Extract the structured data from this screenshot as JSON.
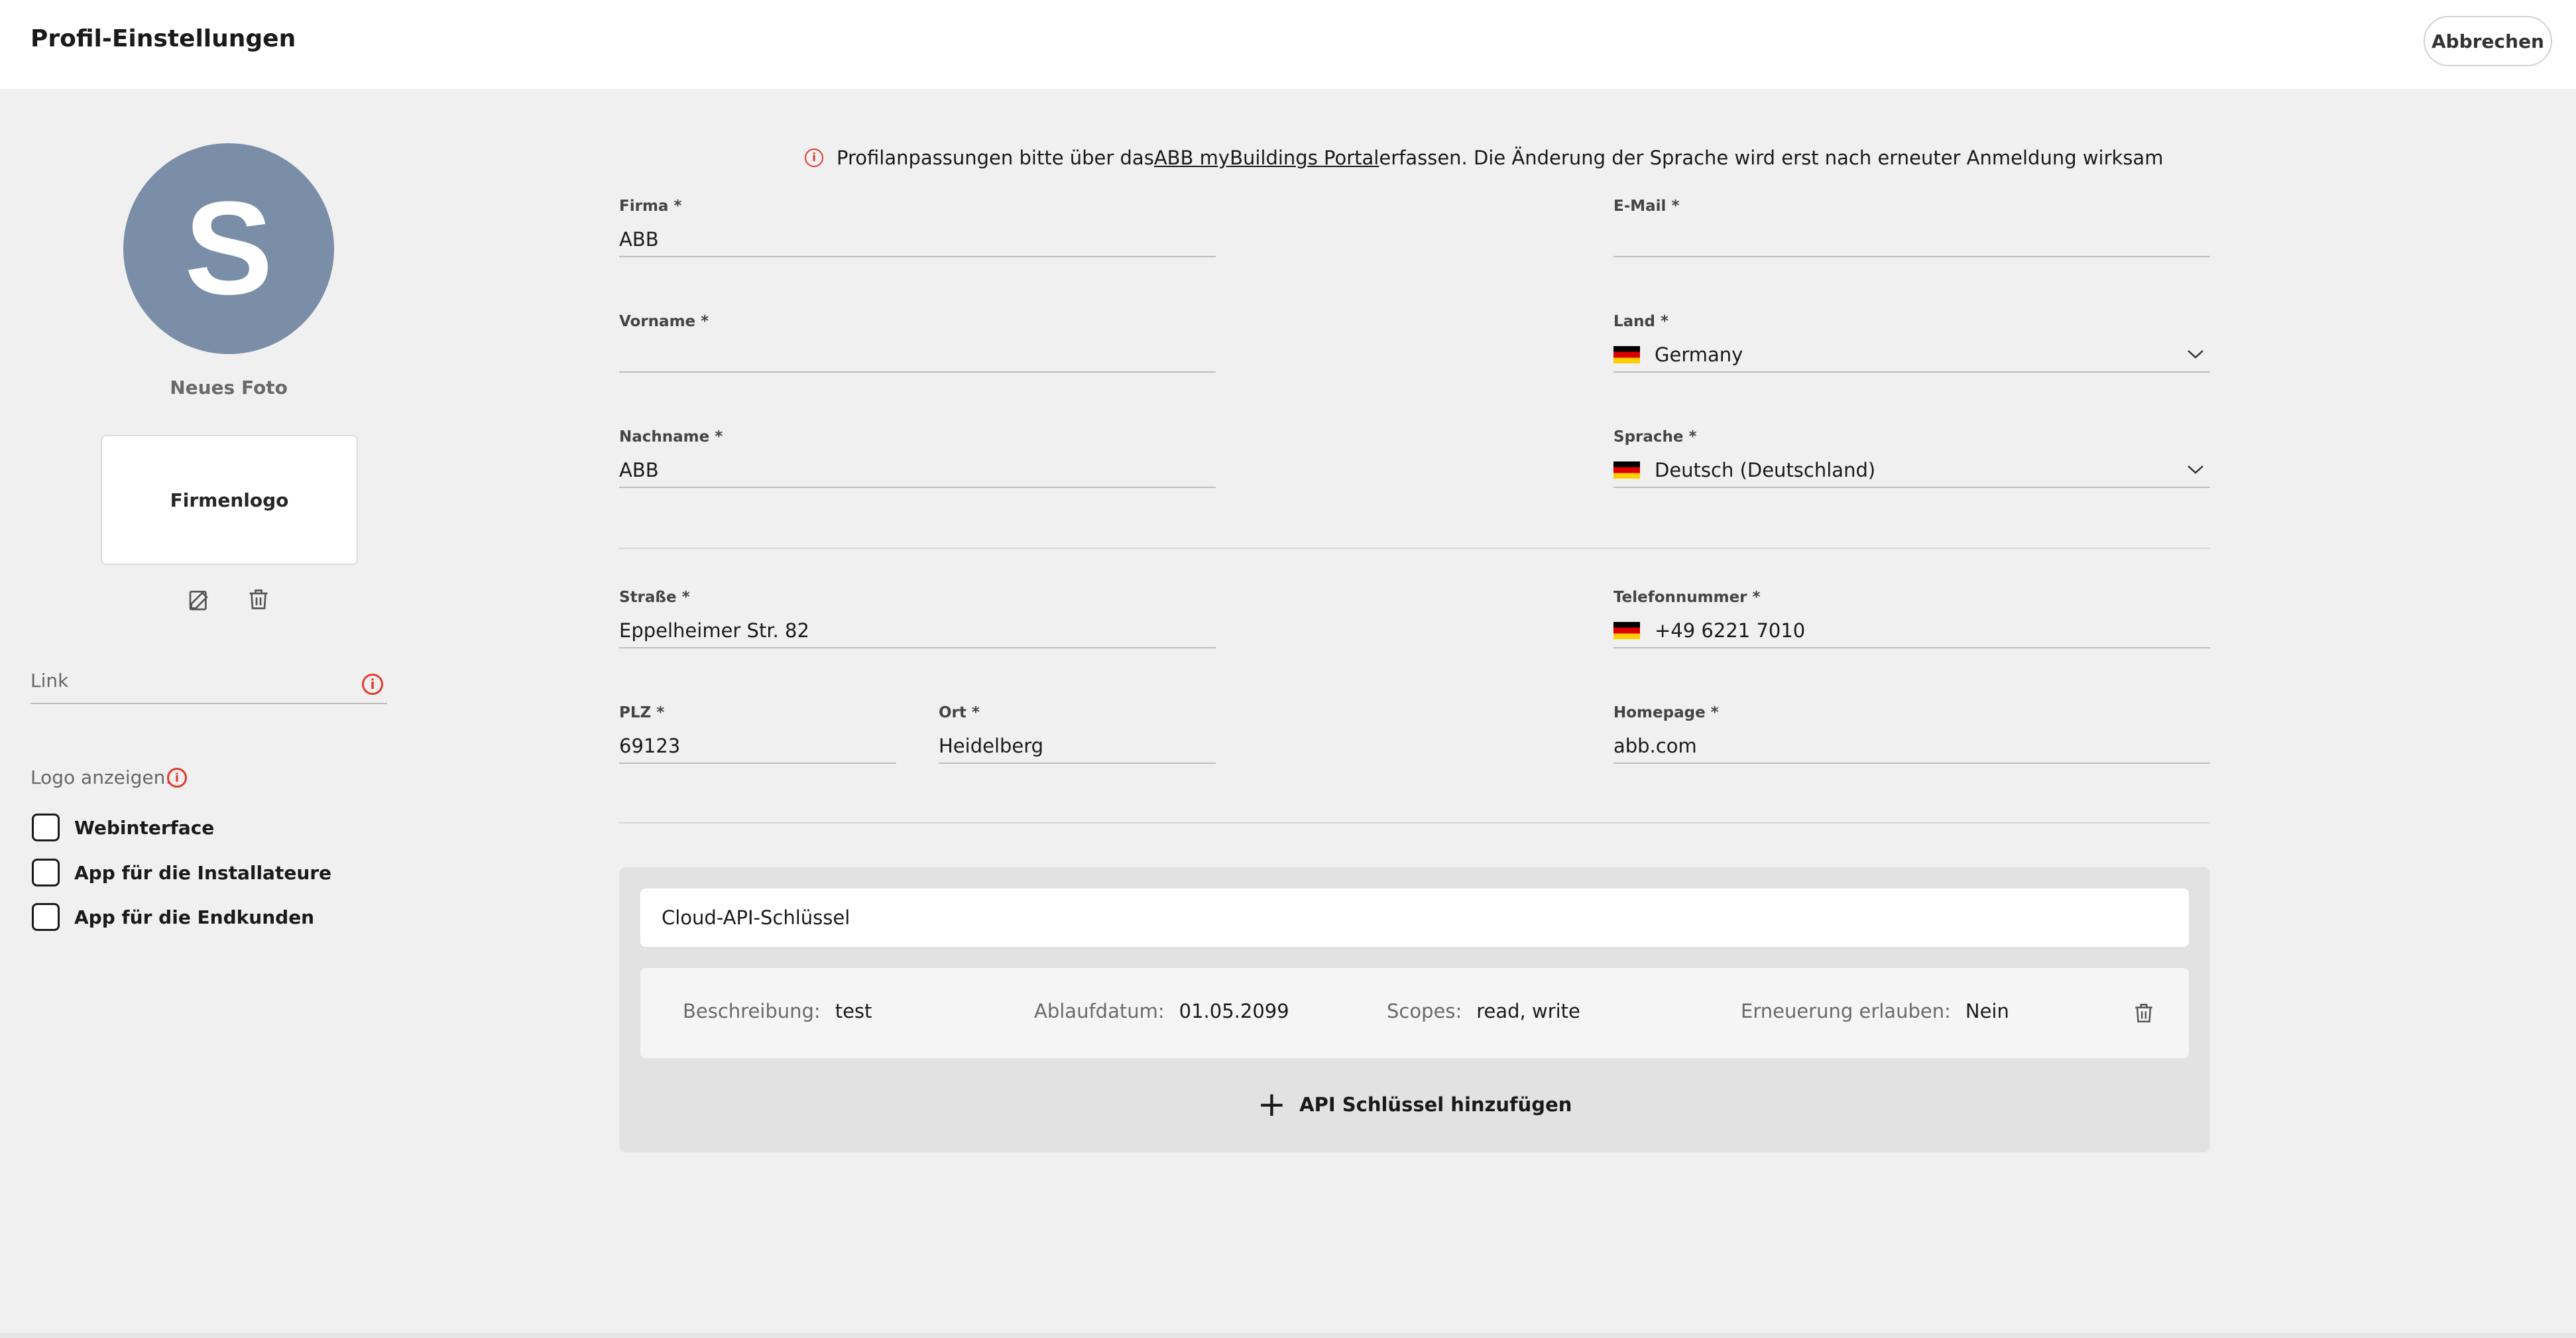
{
  "header": {
    "title": "Profil-Einstellungen",
    "cancel_label": "Abbrechen"
  },
  "left": {
    "avatar_letter": "S",
    "new_photo_label": "Neues Foto",
    "company_logo_label": "Firmenlogo",
    "link_label": "Link",
    "show_logo_label": "Logo anzeigen:",
    "checkboxes": [
      {
        "label": "Webinterface",
        "checked": false
      },
      {
        "label": "App für die Installateure",
        "checked": false
      },
      {
        "label": "App für die Endkunden",
        "checked": false
      }
    ]
  },
  "banner": {
    "text_before": "Profilanpassungen bitte über das ",
    "link_text": "ABB myBuildings Portal",
    "text_after": " erfassen. Die Änderung der Sprache wird erst nach erneuter Anmeldung wirksam"
  },
  "form": {
    "company": {
      "label": "Firma *",
      "value": "ABB"
    },
    "email": {
      "label": "E-Mail *",
      "value": ""
    },
    "firstname": {
      "label": "Vorname *",
      "value": ""
    },
    "country": {
      "label": "Land *",
      "value": "Germany"
    },
    "lastname": {
      "label": "Nachname *",
      "value": "ABB"
    },
    "language": {
      "label": "Sprache *",
      "value": "Deutsch (Deutschland)"
    },
    "street": {
      "label": "Straße *",
      "value": "Eppelheimer Str. 82"
    },
    "phone": {
      "label": "Telefonnummer *",
      "value": "+49 6221 7010"
    },
    "zip": {
      "label": "PLZ *",
      "value": "69123"
    },
    "city": {
      "label": "Ort *",
      "value": "Heidelberg"
    },
    "homepage": {
      "label": "Homepage *",
      "value": "abb.com"
    }
  },
  "api": {
    "title": "Cloud-API-Schlüssel",
    "keys": [
      {
        "description_label": "Beschreibung:",
        "description": "test",
        "expiry_label": "Ablaufdatum:",
        "expiry": "01.05.2099",
        "scopes_label": "Scopes:",
        "scopes": "read, write",
        "renew_label": "Erneuerung erlauben:",
        "renew": "Nein"
      }
    ],
    "add_label": "API Schlüssel hinzufügen"
  },
  "colors": {
    "avatar_bg": "#7a8ea8",
    "info_red": "#e23b2e",
    "page_bg": "#f0f0f0"
  }
}
